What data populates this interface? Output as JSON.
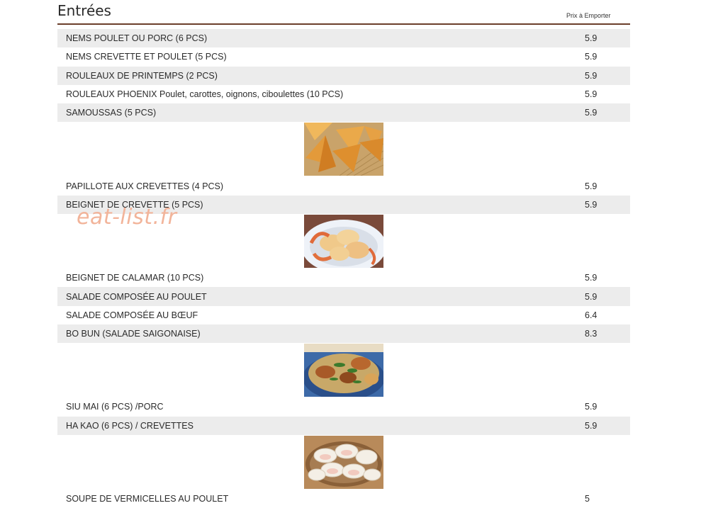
{
  "title": "Entrées",
  "price_column_header": "Prix à Emporter",
  "watermark": "eat-list.fr",
  "items": [
    {
      "name": "NEMS POULET OU PORC (6 PCS)",
      "price": "5.9"
    },
    {
      "name": "NEMS CREVETTE ET POULET (5 PCS)",
      "price": "5.9"
    },
    {
      "name": "ROULEAUX DE PRINTEMPS (2 PCS)",
      "price": "5.9"
    },
    {
      "name": "ROULEAUX PHOENIX Poulet, carottes, oignons, ciboulettes (10 PCS)",
      "price": "5.9"
    },
    {
      "name": "SAMOUSSAS (5 PCS)",
      "price": "5.9"
    },
    {
      "name": "PAPILLOTE AUX CREVETTES (4 PCS)",
      "price": "5.9"
    },
    {
      "name": "BEIGNET DE CREVETTE (5 PCS)",
      "price": "5.9"
    },
    {
      "name": "BEIGNET DE CALAMAR (10 PCS)",
      "price": "5.9"
    },
    {
      "name": "SALADE COMPOSÉE AU POULET",
      "price": "5.9"
    },
    {
      "name": "SALADE COMPOSÉE AU BŒUF",
      "price": "6.4"
    },
    {
      "name": "BO BUN (SALADE SAIGONAISE)",
      "price": "8.3"
    },
    {
      "name": "SIU MAI (6 PCS) /PORC",
      "price": "5.9"
    },
    {
      "name": "HA KAO (6 PCS) / CREVETTES",
      "price": "5.9"
    },
    {
      "name": "SOUPE DE VERMICELLES AU POULET",
      "price": "5"
    }
  ],
  "photos": [
    {
      "icon": "samosa-photo-icon"
    },
    {
      "icon": "fried-shrimp-photo-icon"
    },
    {
      "icon": "bo-bun-photo-icon"
    },
    {
      "icon": "dumplings-photo-icon"
    }
  ]
}
